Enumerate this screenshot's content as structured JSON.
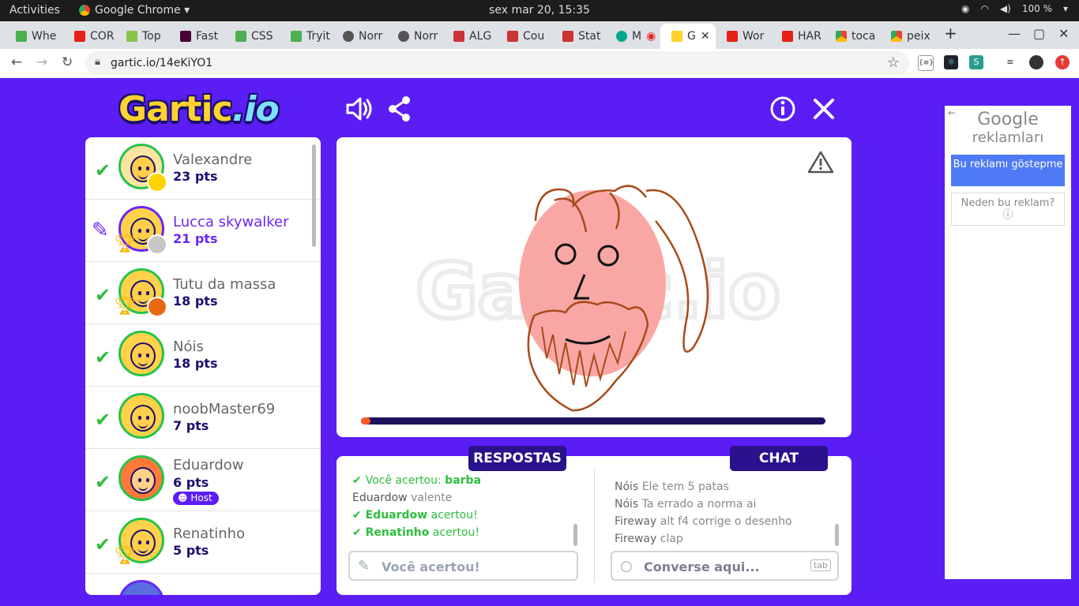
{
  "os": {
    "activities": "Activities",
    "app_name": "Google Chrome ▾",
    "clock": "sex mar 20, 15:35",
    "battery": "100 %"
  },
  "browser": {
    "tabs": [
      "Whe",
      "COR",
      "Top",
      "Fast",
      "CSS",
      "Tryit",
      "Norr",
      "Norr",
      "ALG",
      "Cou",
      "Stat",
      "M",
      "G",
      "Wor",
      "HAR",
      "toca",
      "peix"
    ],
    "url": "gartic.io/14eKiYO1"
  },
  "game": {
    "logo_main": "Gartic",
    "logo_suffix": ".io",
    "players": [
      {
        "name": "Valexandre",
        "pts": "23 pts",
        "status": "guessed",
        "medal_color": "#ffd400"
      },
      {
        "name": "Lucca skywalker",
        "pts": "21 pts",
        "status": "drawing",
        "trophy": "1",
        "medal_color": "#c7c7c7"
      },
      {
        "name": "Tutu da massa",
        "pts": "18 pts",
        "status": "guessed",
        "trophy": "1",
        "medal_color": "#e86a10"
      },
      {
        "name": "Nóis",
        "pts": "18 pts",
        "status": "guessed"
      },
      {
        "name": "noobMaster69",
        "pts": "7 pts",
        "status": "guessed"
      },
      {
        "name": "Eduardow",
        "pts": "6 pts",
        "status": "guessed",
        "badge": "Host"
      },
      {
        "name": "Renatinho",
        "pts": "5 pts",
        "status": "guessed",
        "trophy": "1"
      }
    ],
    "timer_fraction": 0.02,
    "answers_title": "RESPOSTAS",
    "chat_title": "CHAT",
    "answers": [
      {
        "who": "Você acertou:",
        "word": "barba",
        "type": "correct-self"
      },
      {
        "who": "Eduardow",
        "word": "valente",
        "type": "guess"
      },
      {
        "who": "Eduardow",
        "word": "acertou!",
        "type": "correct"
      },
      {
        "who": "Renatinho",
        "word": "acertou!",
        "type": "correct"
      }
    ],
    "chat": [
      {
        "who": "Nóis",
        "text": "Ele tem 5 patas"
      },
      {
        "who": "Nóis",
        "text": "Ta errado a norma ai"
      },
      {
        "who": "Fireway",
        "text": "alt f4 corrige o desenho"
      },
      {
        "who": "Fireway",
        "text": "clap"
      }
    ],
    "answer_placeholder": "Você acertou!",
    "chat_placeholder": "Converse aqui...",
    "tab_hint": "tab"
  },
  "ad": {
    "brand": "Google",
    "subtitle": "reklamları",
    "stop_button": "Bu reklamı göstерme",
    "why_button": "Neden bu reklam?"
  }
}
